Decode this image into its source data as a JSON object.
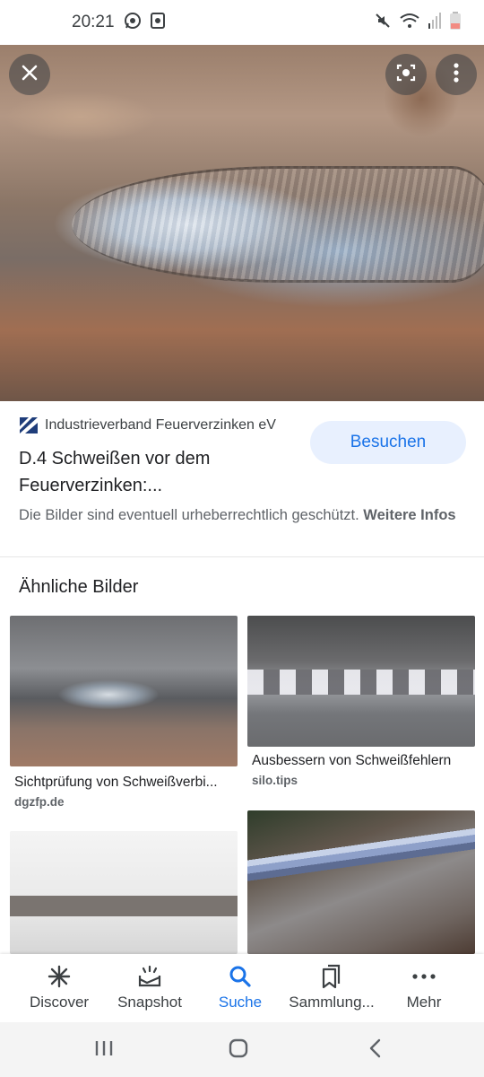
{
  "status_bar": {
    "time": "20:21",
    "icons_left": [
      "whatsapp-icon",
      "sim-icon"
    ],
    "icons_right": [
      "mute-icon",
      "wifi-icon",
      "signal-icon",
      "battery-icon"
    ]
  },
  "viewer": {
    "close_icon": "close-icon",
    "lens_icon": "lens-icon",
    "more_icon": "more-vert-icon"
  },
  "result": {
    "source_name": "Industrieverband Feuerverzinken eV",
    "visit_label": "Besuchen",
    "title": "D.4 Schweißen vor dem Feuerverzinken:...",
    "copyright_text": "Die Bilder sind eventuell urheberrechtlich geschützt.",
    "more_info_label": "Weitere Infos"
  },
  "similar": {
    "heading": "Ähnliche Bilder",
    "items": [
      {
        "caption": "Sichtprüfung von Schweißverbi...",
        "source": "dgzfp.de"
      },
      {
        "caption": "Ausbessern von Schweißfehlern",
        "source": "silo.tips"
      },
      {
        "caption": "",
        "source": ""
      },
      {
        "caption": "",
        "source": ""
      }
    ]
  },
  "bottom_nav": {
    "items": [
      {
        "label": "Discover",
        "icon": "asterisk-icon",
        "active": false
      },
      {
        "label": "Snapshot",
        "icon": "snapshot-icon",
        "active": false
      },
      {
        "label": "Suche",
        "icon": "search-icon",
        "active": true
      },
      {
        "label": "Sammlung...",
        "icon": "collections-icon",
        "active": false
      },
      {
        "label": "Mehr",
        "icon": "more-horiz-icon",
        "active": false
      }
    ]
  },
  "colors": {
    "accent": "#1a73e8",
    "visit_bg": "#e8f0fe",
    "text_secondary": "#5f6368"
  }
}
